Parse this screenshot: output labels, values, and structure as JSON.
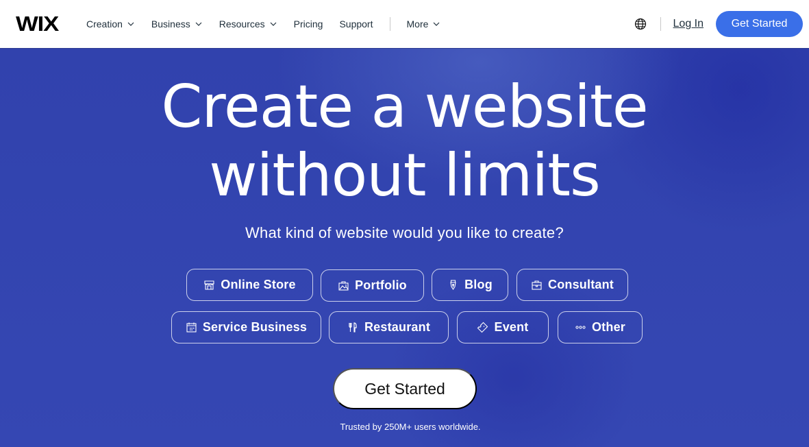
{
  "header": {
    "logo": "WIX",
    "nav": [
      {
        "label": "Creation",
        "has_dropdown": true
      },
      {
        "label": "Business",
        "has_dropdown": true
      },
      {
        "label": "Resources",
        "has_dropdown": true
      },
      {
        "label": "Pricing",
        "has_dropdown": false
      },
      {
        "label": "Support",
        "has_dropdown": false
      }
    ],
    "more": {
      "label": "More",
      "has_dropdown": true
    },
    "language_icon": "globe-icon",
    "login_label": "Log In",
    "cta_label": "Get Started"
  },
  "hero": {
    "headline_line1": "Create a website",
    "headline_line2": "without limits",
    "subtitle": "What kind of website would you like to create?",
    "categories": [
      {
        "label": "Online Store",
        "icon": "store-icon"
      },
      {
        "label": "Portfolio",
        "icon": "portfolio-icon"
      },
      {
        "label": "Blog",
        "icon": "pen-nib-icon"
      },
      {
        "label": "Consultant",
        "icon": "briefcase-icon"
      },
      {
        "label": "Service Business",
        "icon": "calendar-icon"
      },
      {
        "label": "Restaurant",
        "icon": "utensils-icon"
      },
      {
        "label": "Event",
        "icon": "ticket-icon"
      },
      {
        "label": "Other",
        "icon": "more-dots-icon"
      }
    ],
    "cta_label": "Get Started",
    "trusted_text": "Trusted by 250M+ users worldwide."
  },
  "colors": {
    "accent": "#3a6fe8",
    "hero_background": "#3244b0",
    "text_dark": "#20303c"
  }
}
